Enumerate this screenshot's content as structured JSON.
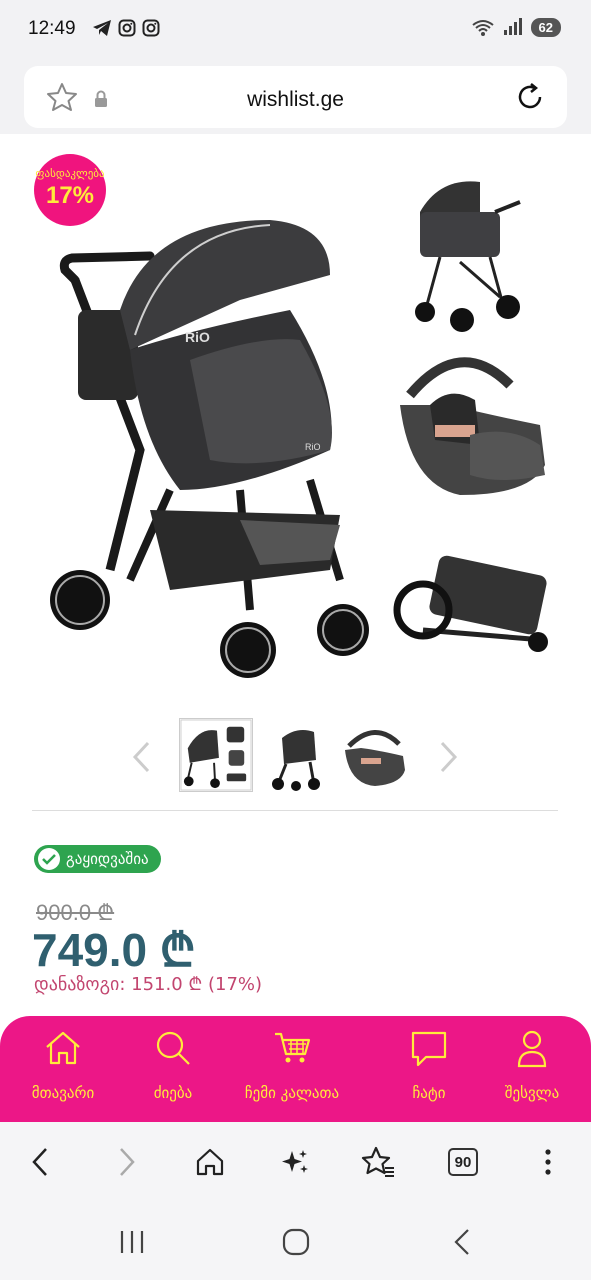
{
  "status_bar": {
    "time": "12:49",
    "battery": "62"
  },
  "browser": {
    "url": "wishlist.ge",
    "tab_count": "90"
  },
  "product": {
    "discount_label": "ფასდაკლება",
    "discount_percent": "17%",
    "stock_status": "გაყიდვაშია",
    "old_price": "900.0 ₾",
    "new_price": "749.0 ₾",
    "savings_label": "დანაზოგი:",
    "savings_value": "151.0 ₾ (17%)",
    "image_logo_text": "RiO"
  },
  "site_nav": {
    "items": [
      {
        "label": "მთავარი",
        "icon": "home-icon"
      },
      {
        "label": "ძიება",
        "icon": "search-icon"
      },
      {
        "label": "ჩემი კალათა",
        "icon": "cart-icon"
      },
      {
        "label": "ჩატი",
        "icon": "chat-icon"
      },
      {
        "label": "შესვლა",
        "icon": "user-icon"
      }
    ]
  },
  "colors": {
    "brand_pink": "#ec1787",
    "nav_text": "#ffeb3b",
    "price": "#2f5f6f",
    "stock_green": "#2ea44f"
  }
}
